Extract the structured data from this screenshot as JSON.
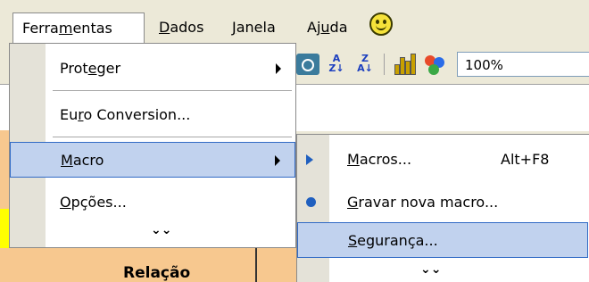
{
  "menubar": {
    "ferramentas": {
      "pre": "Ferra",
      "u": "m",
      "post": "entas"
    },
    "dados": {
      "pre": "",
      "u": "D",
      "post": "ados"
    },
    "janela": {
      "pre": "",
      "u": "J",
      "post": "anela"
    },
    "ajuda": {
      "pre": "Aj",
      "u": "u",
      "post": "da"
    }
  },
  "toolbar": {
    "zoom_value": "100%",
    "sort_asc_glyph": "A\nZ↓",
    "sort_desc_glyph": "Z\nA↓"
  },
  "sheet": {
    "partial_cell_text": "Relação"
  },
  "main_menu": {
    "items": [
      {
        "pre": "Prot",
        "u": "e",
        "post": "ger",
        "has_submenu": true
      },
      {
        "pre": "Eu",
        "u": "r",
        "post": "o Conversion...",
        "has_submenu": false
      },
      {
        "pre": "",
        "u": "M",
        "post": "acro",
        "has_submenu": true,
        "highlighted": true
      },
      {
        "pre": "",
        "u": "O",
        "post": "pções...",
        "has_submenu": false
      }
    ],
    "expand_glyph": "⌄⌄"
  },
  "submenu": {
    "items": [
      {
        "pre": "",
        "u": "M",
        "post": "acros...",
        "accel": "Alt+F8",
        "icon": "play-icon"
      },
      {
        "pre": "",
        "u": "G",
        "post": "ravar nova macro...",
        "accel": "",
        "icon": "record-icon"
      },
      {
        "pre": "",
        "u": "S",
        "post": "egurança...",
        "accel": "",
        "icon": "",
        "highlighted": true
      }
    ],
    "expand_glyph": "⌄⌄"
  },
  "colors": {
    "menu_bg": "#ece9d8",
    "highlight": "#c1d2ee",
    "highlight_border": "#316ac5",
    "gutter": "#e4e2d8",
    "sheet_orange": "#f7c88f",
    "sheet_yellow": "#ffff00"
  }
}
